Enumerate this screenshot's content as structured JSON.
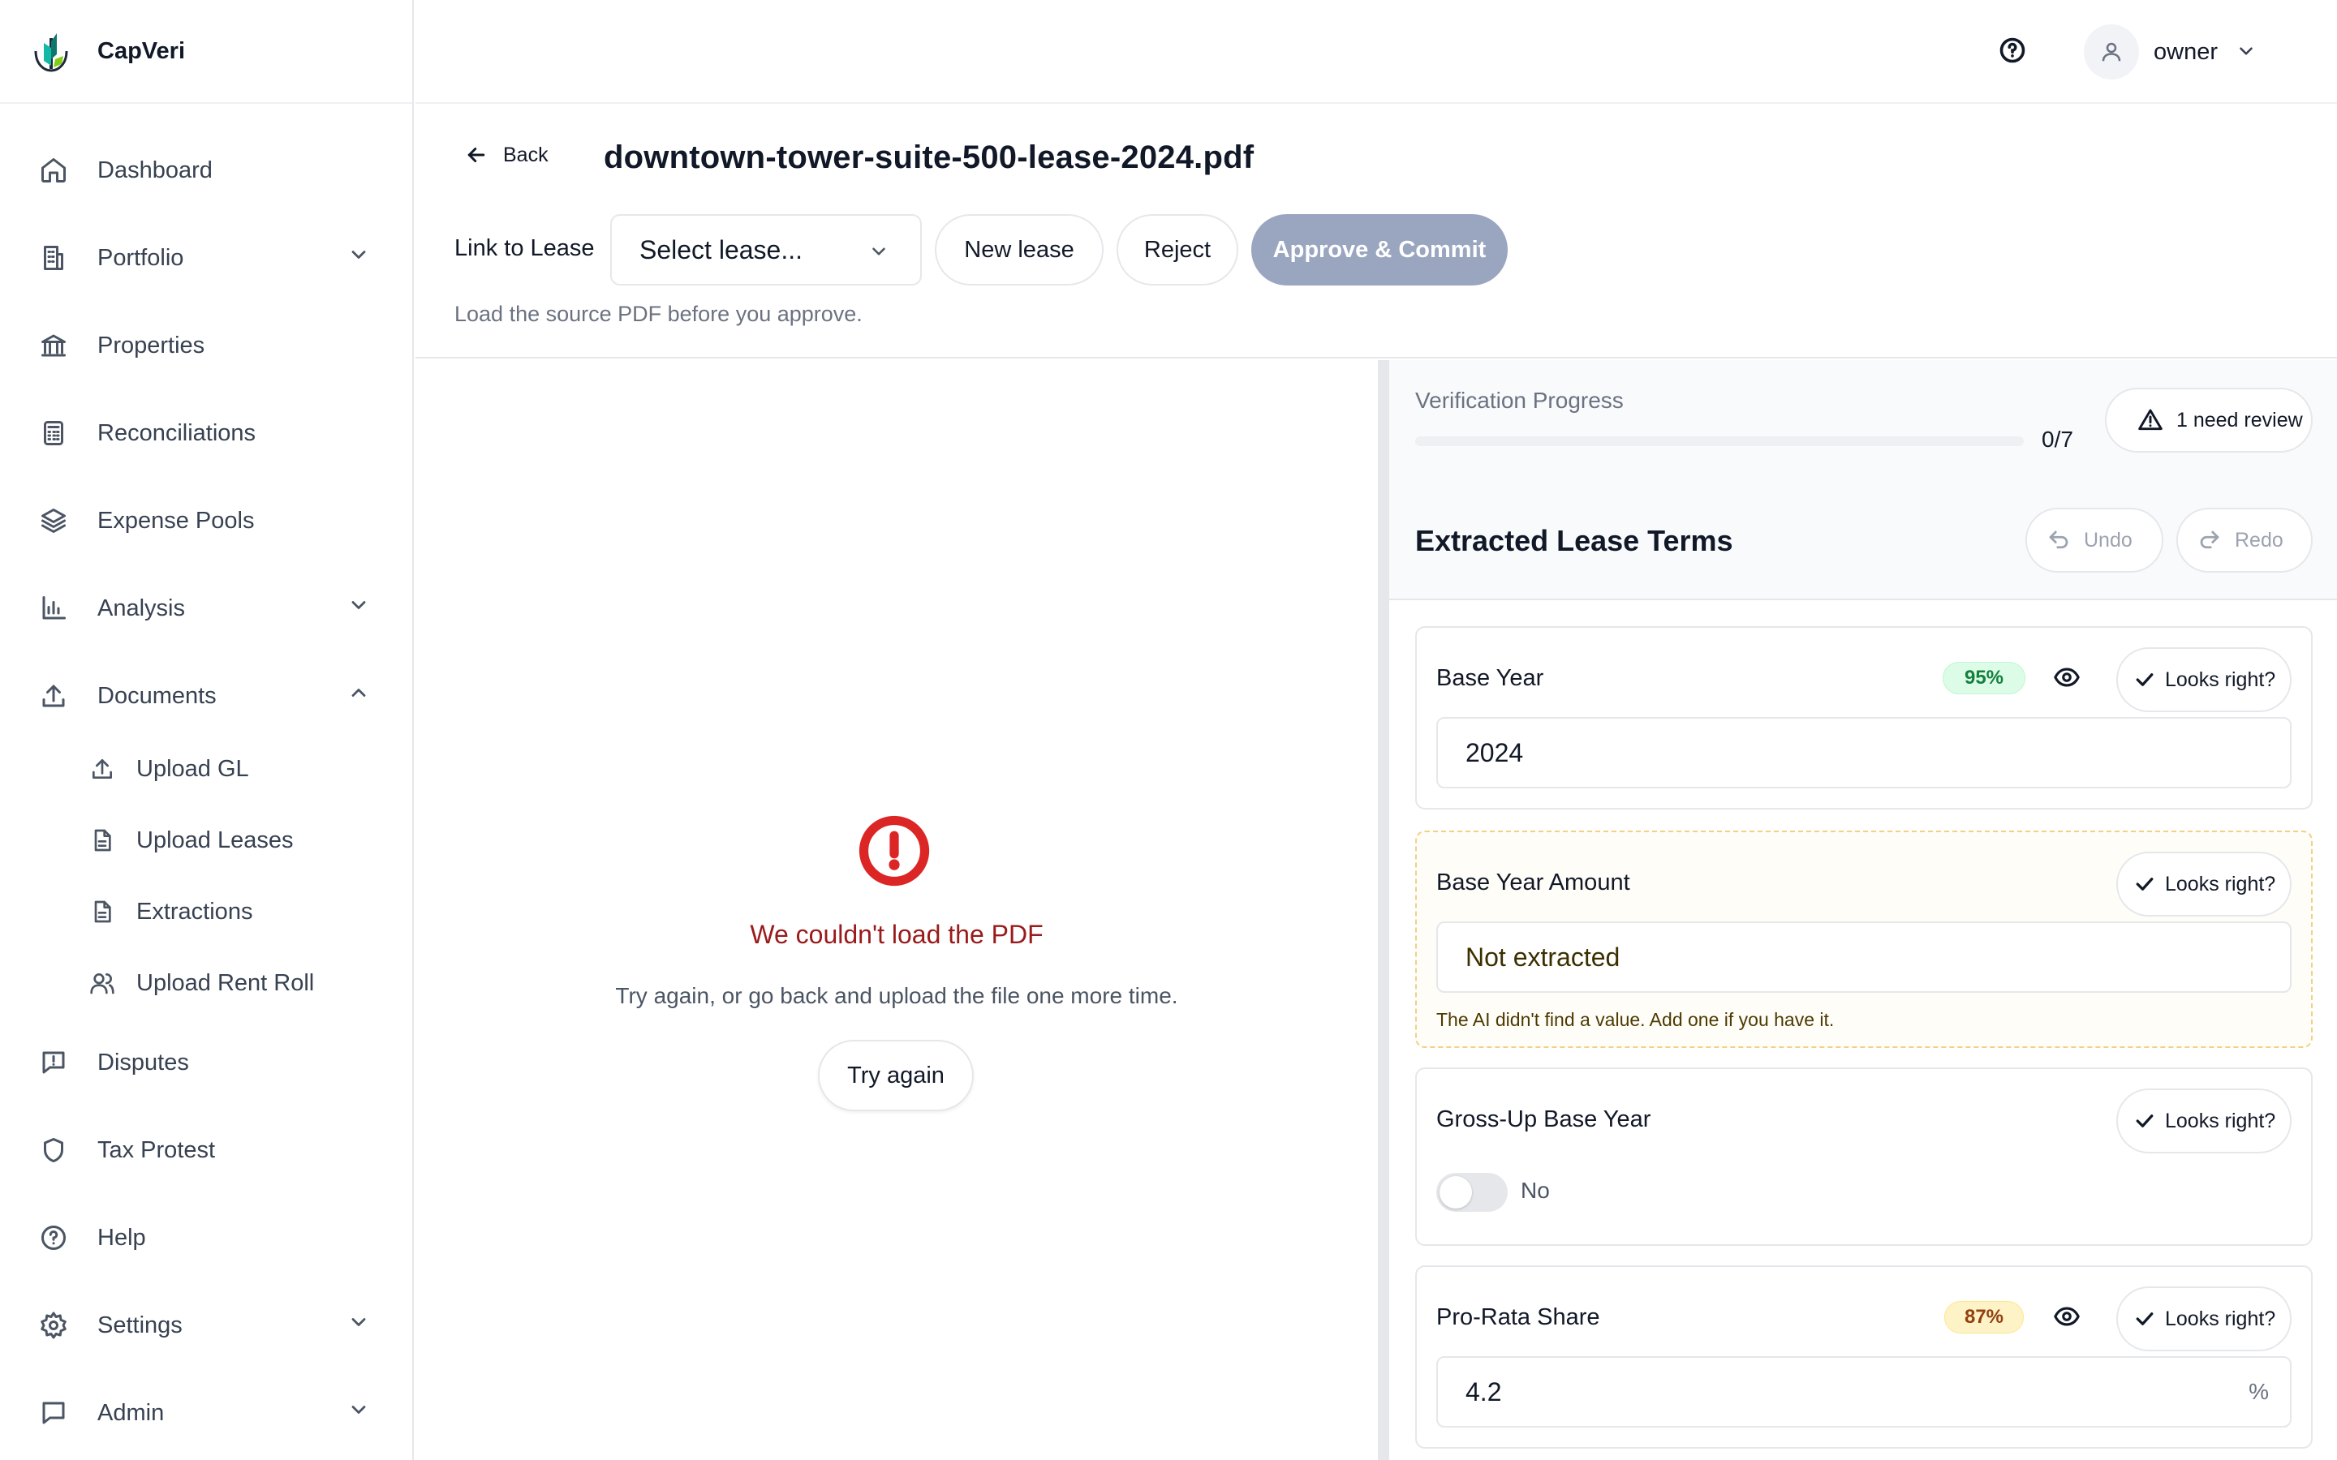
{
  "brand": {
    "name": "CapVeri"
  },
  "sidebar": {
    "items": [
      {
        "label": "Dashboard",
        "icon": "home-icon"
      },
      {
        "label": "Portfolio",
        "icon": "building-icon",
        "chevron": "down"
      },
      {
        "label": "Properties",
        "icon": "bank-icon"
      },
      {
        "label": "Reconciliations",
        "icon": "calculator-icon"
      },
      {
        "label": "Expense Pools",
        "icon": "layers-icon"
      },
      {
        "label": "Analysis",
        "icon": "bar-chart-icon",
        "chevron": "down"
      },
      {
        "label": "Documents",
        "icon": "upload-icon",
        "chevron": "up"
      },
      {
        "label": "Disputes",
        "icon": "message-alert-icon"
      },
      {
        "label": "Tax Protest",
        "icon": "shield-icon"
      },
      {
        "label": "Help",
        "icon": "help-circle-icon"
      },
      {
        "label": "Settings",
        "icon": "gear-icon",
        "chevron": "down"
      },
      {
        "label": "Admin",
        "icon": "message-square-icon",
        "chevron": "down"
      }
    ],
    "documents_sub": [
      {
        "label": "Upload GL",
        "icon": "upload-icon"
      },
      {
        "label": "Upload Leases",
        "icon": "file-text-icon"
      },
      {
        "label": "Extractions",
        "icon": "file-text-icon"
      },
      {
        "label": "Upload Rent Roll",
        "icon": "users-icon"
      }
    ]
  },
  "topbar": {
    "user_name": "owner"
  },
  "header": {
    "back_label": "Back",
    "file_title": "downtown-tower-suite-500-lease-2024.pdf",
    "link_label": "Link to Lease",
    "lease_select": "Select lease...",
    "new_lease": "New lease",
    "reject": "Reject",
    "approve": "Approve & Commit",
    "hint": "Load the source PDF before you approve."
  },
  "pdf": {
    "error_title": "We couldn't load the PDF",
    "error_sub": "Try again, or go back and upload the file one more time.",
    "retry": "Try again"
  },
  "verification": {
    "title": "Verification Progress",
    "count": "0/7",
    "progress": 0,
    "review": "1 need review"
  },
  "terms": {
    "title": "Extracted Lease Terms",
    "undo": "Undo",
    "redo": "Redo",
    "looks_right": "Looks right?",
    "fields": [
      {
        "label": "Base Year",
        "confidence": "95%",
        "value": "2024"
      },
      {
        "label": "Base Year Amount",
        "value": "Not extracted",
        "warning": "The AI didn't find a value. Add one if you have it."
      },
      {
        "label": "Gross-Up Base Year",
        "toggle_value": "No"
      },
      {
        "label": "Pro-Rata Share",
        "confidence": "87%",
        "value": "4.2",
        "suffix": "%"
      }
    ]
  },
  "colors": {
    "accent_disabled": "#9aa6bf",
    "error": "#dc2626",
    "conf_green": "#15803d",
    "conf_amber": "#92400e"
  }
}
